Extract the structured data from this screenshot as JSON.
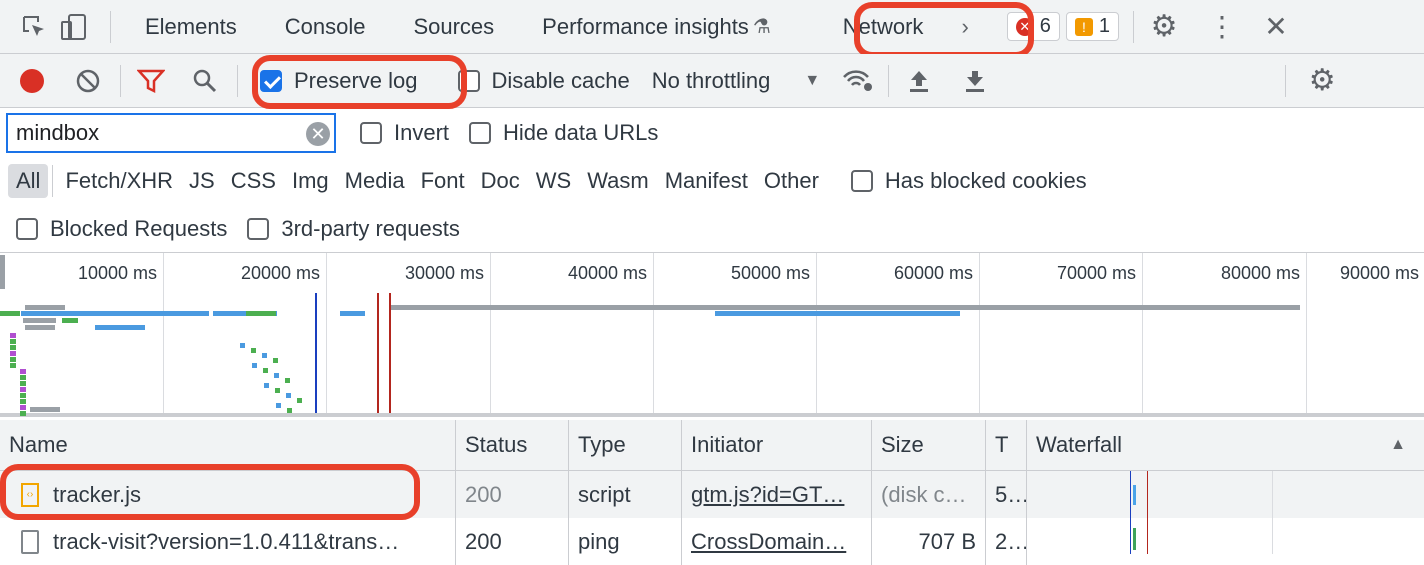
{
  "tabs": [
    "Elements",
    "Console",
    "Sources",
    "Performance insights",
    "Network"
  ],
  "active_tab": "Network",
  "errors_count": "6",
  "warnings_count": "1",
  "toolbar": {
    "preserve_log": "Preserve log",
    "preserve_log_checked": true,
    "disable_cache": "Disable cache",
    "throttling": "No throttling"
  },
  "filter": {
    "value": "mindbox",
    "invert": "Invert",
    "hide_data_urls": "Hide data URLs"
  },
  "types": [
    "All",
    "Fetch/XHR",
    "JS",
    "CSS",
    "Img",
    "Media",
    "Font",
    "Doc",
    "WS",
    "Wasm",
    "Manifest",
    "Other"
  ],
  "has_blocked_cookies": "Has blocked cookies",
  "blocked_requests": "Blocked Requests",
  "third_party": "3rd-party requests",
  "overview_ticks": [
    "10000 ms",
    "20000 ms",
    "30000 ms",
    "40000 ms",
    "50000 ms",
    "60000 ms",
    "70000 ms",
    "80000 ms",
    "90000 ms"
  ],
  "columns": [
    "Name",
    "Status",
    "Type",
    "Initiator",
    "Size",
    "T",
    "Waterfall"
  ],
  "rows": [
    {
      "name": "tracker.js",
      "status": "200",
      "type": "script",
      "initiator": "gtm.js?id=GT…",
      "size": "(disk c…",
      "time": "5…",
      "icon": "script-file-icon"
    },
    {
      "name": "track-visit?version=1.0.411&trans…",
      "status": "200",
      "type": "ping",
      "initiator": "CrossDomain…",
      "size": "707 B",
      "time": "2…",
      "icon": "document-file-icon"
    }
  ],
  "colors": {
    "highlight": "#e8402a",
    "accent": "#1a73e8",
    "record": "#d93025"
  }
}
